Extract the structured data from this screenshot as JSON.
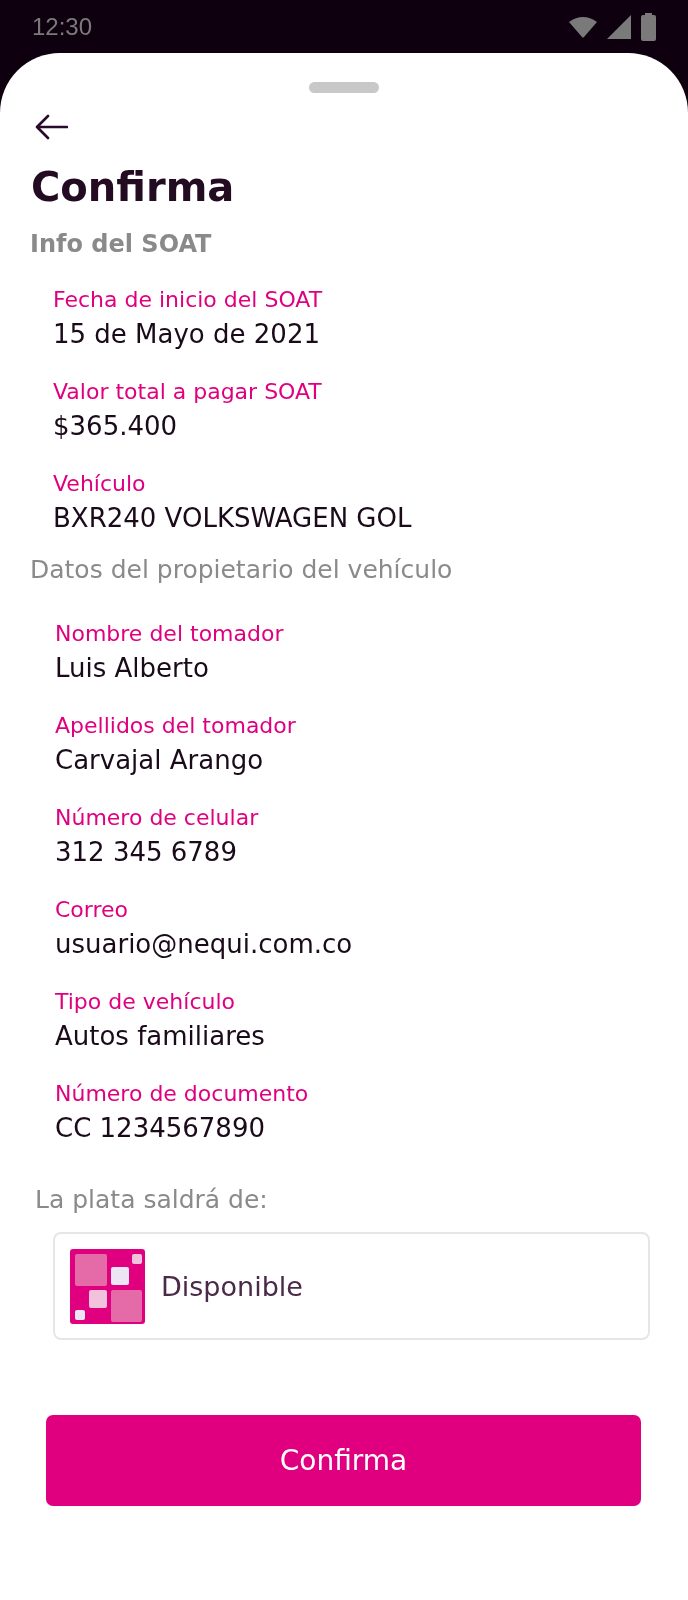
{
  "status_bar": {
    "time": "12:30"
  },
  "title": "Confirma",
  "sections": [
    {
      "heading": "Info del SOAT",
      "kind": "bold",
      "items": [
        {
          "label": "Fecha de inicio del SOAT",
          "value": "15 de Mayo de 2021"
        },
        {
          "label": "Valor total a pagar SOAT",
          "value": "$365.400"
        },
        {
          "label": "Vehículo",
          "value": "BXR240 VOLKSWAGEN GOL"
        }
      ]
    },
    {
      "heading": "Datos del propietario del vehículo",
      "kind": "plain",
      "items": [
        {
          "label": "Nombre del tomador",
          "value": "Luis Alberto"
        },
        {
          "label": "Apellidos del tomador",
          "value": "Carvajal Arango"
        },
        {
          "label": "Número de celular",
          "value": "312 345 6789"
        },
        {
          "label": "Correo",
          "value": "usuario@nequi.com.co"
        },
        {
          "label": "Tipo de vehículo",
          "value": "Autos familiares"
        },
        {
          "label": "Número de documento",
          "value": "CC 1234567890"
        }
      ]
    }
  ],
  "payment": {
    "heading": "La plata saldrá de:",
    "source": "Disponible"
  },
  "button": "Confirma"
}
